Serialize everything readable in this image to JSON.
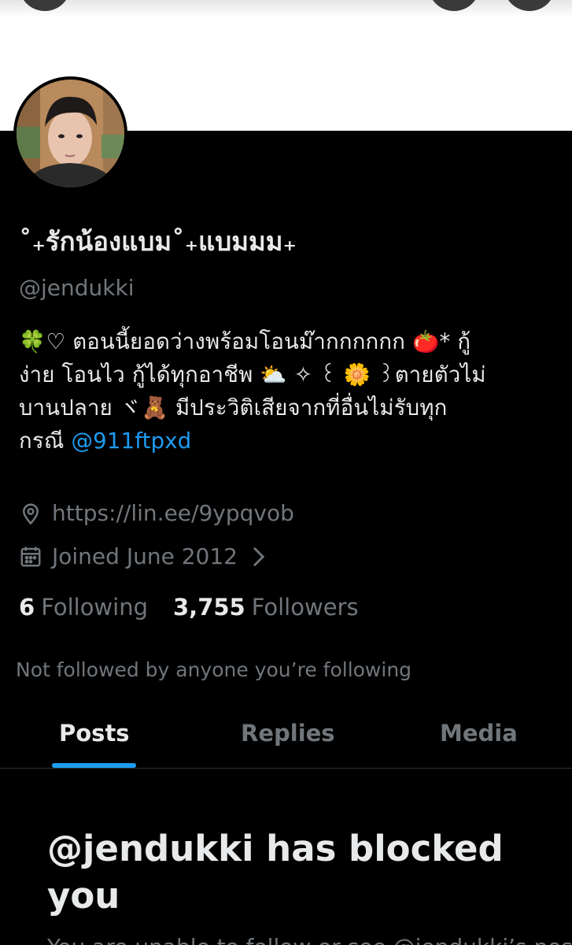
{
  "profile": {
    "display_name": "˚₊รักน้องแบม˚₊แบมมม₊",
    "handle": "@jendukki",
    "bio": {
      "line1": "🍀♡ ตอนนี้ยอดว่างพร้อมโอนม๊ากกกกกก 🍅* กู้",
      "line2": "ง่าย โอนไว กู้ได้ทุกอาชีพ ⛅ ✧ ꒰ 🌼 ꒱ตายตัวไม่",
      "line3": "บานปลาย ヾ🧸 มีประวิติเสียจากที่อื่นไม่รับทุก",
      "line4_text": "กรณี ",
      "line4_mention": "@911ftpxd"
    },
    "url": "https://lin.ee/9ypqvob",
    "joined": "Joined June 2012",
    "following_count": "6",
    "following_label": "Following",
    "followers_count": "3,755",
    "followers_label": "Followers",
    "not_followed_text": "Not followed by anyone you’re following"
  },
  "tabs": [
    {
      "label": "Posts",
      "active": true
    },
    {
      "label": "Replies",
      "active": false
    },
    {
      "label": "Media",
      "active": false
    }
  ],
  "blocked": {
    "title": "@jendukki has blocked you",
    "subtitle": "You are unable to follow or see @jendukki’s posts."
  },
  "icons": {
    "url": "location-pin-icon",
    "joined": "calendar-icon",
    "chevron": "chevron-right-icon"
  },
  "colors": {
    "background": "#000000",
    "banner": "#ffffff",
    "primary_text": "#e7e9ea",
    "secondary_text": "#71767b",
    "accent": "#1d9bf0",
    "divider": "#2f3336"
  }
}
